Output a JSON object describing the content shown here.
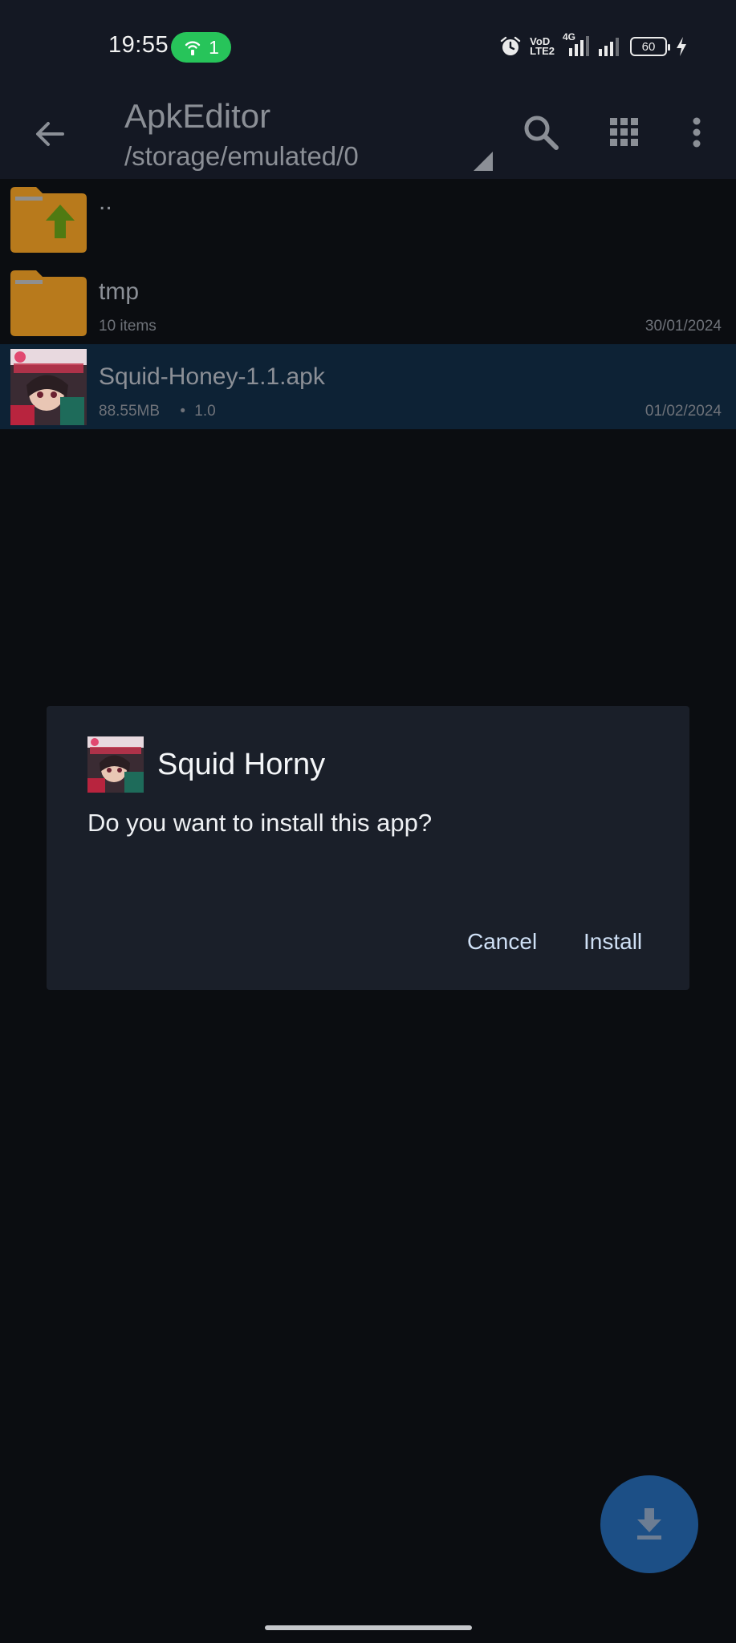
{
  "status_bar": {
    "time": "19:55",
    "hotspot_count": "1",
    "volte_text_top": "VoD",
    "volte_text_bottom": "LTE2",
    "network_type": "4G",
    "battery_level": "60"
  },
  "toolbar": {
    "title": "ApkEditor",
    "path": "/storage/emulated/0"
  },
  "files": [
    {
      "name": "..",
      "type": "parent-folder",
      "sub": "",
      "date": ""
    },
    {
      "name": "tmp",
      "type": "folder",
      "sub": "10 items",
      "date": "30/01/2024"
    },
    {
      "name": "Squid-Honey-1.1.apk",
      "type": "apk",
      "size": "88.55MB",
      "version": "1.0",
      "date": "01/02/2024",
      "selected": true
    }
  ],
  "dialog": {
    "title": "Squid Horny",
    "message": "Do you want to install this app?",
    "cancel_label": "Cancel",
    "install_label": "Install"
  },
  "colors": {
    "background": "#0b0d11",
    "toolbar": "#141823",
    "selected_row": "#0d2235",
    "dialog": "#1a1f29",
    "fab": "#1c4f86",
    "folder": "#b87a1c",
    "hotspot_pill": "#27c45a"
  }
}
